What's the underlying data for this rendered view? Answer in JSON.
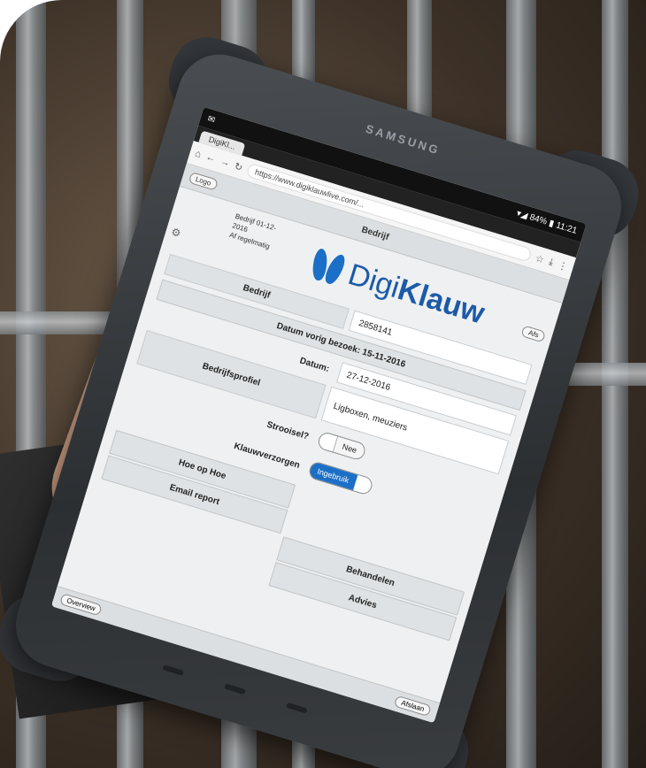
{
  "device": {
    "brand": "SAMSUNG"
  },
  "status_bar": {
    "time": "11:21",
    "battery": "84%"
  },
  "browser": {
    "tab_label": "DigiKl...",
    "url": "https://www.digiklauwlive.com/..."
  },
  "app_bar": {
    "left_button": "Logo",
    "title": "Bedrijf"
  },
  "meta_lines": [
    "Bedrijf 01-12-",
    "2016",
    "Af regelmatig"
  ],
  "logo": {
    "text_light": "Digi",
    "text_bold": "Klauw",
    "color": "#1c6fc6"
  },
  "header_button": "Afs",
  "form": {
    "bedrijf_label": "Bedrijf",
    "bedrijf_value": "2858141",
    "datum_vorig_label": "Datum vorig bezoek: 15-11-2016",
    "datum_label": "Datum:",
    "datum_value": "27-12-2016",
    "bedrijfsprofiel_label": "Bedrijfsprofiel",
    "bedrijfsprofiel_value": "Ligboxen, meuziers",
    "strooisel_label": "Strooisel?",
    "strooisel_value": "Nee",
    "klauwverzorgen_label": "Klauwverzorgen",
    "klauwverzorgen_value": "Ingebruik",
    "hoe_op_hoe_label": "Hoe op Hoe",
    "email_report_label": "Email report",
    "behandelen_label": "Behandelen",
    "advies_label": "Advies"
  },
  "footer": {
    "left": "Overview",
    "right": "Afslaan"
  }
}
